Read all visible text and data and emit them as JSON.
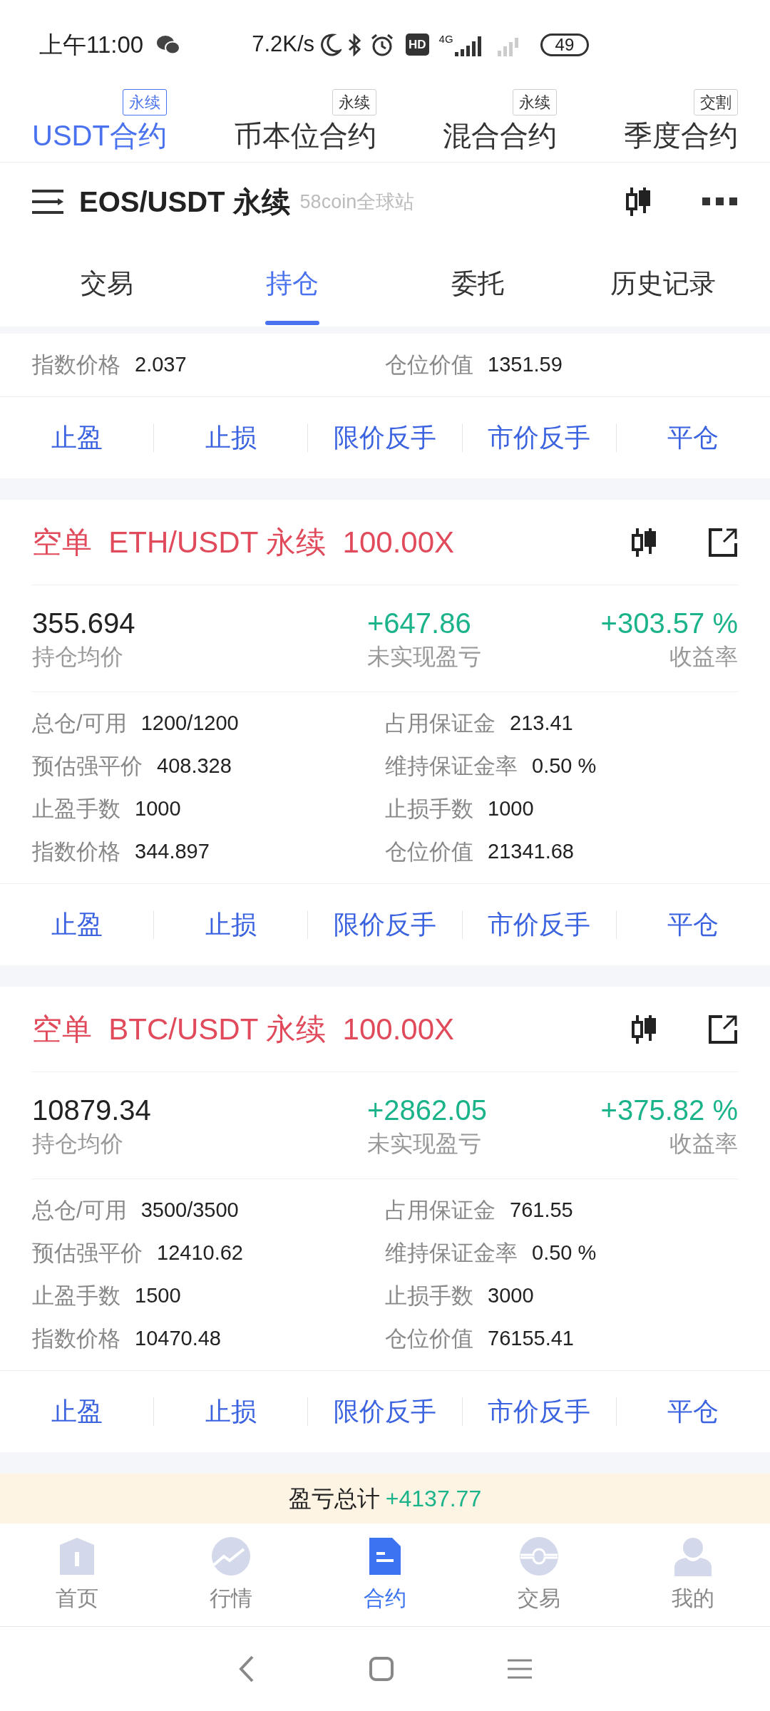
{
  "status_bar": {
    "time": "上午11:00",
    "speed": "7.2K/s",
    "hd": "HD",
    "network": "4G",
    "battery": "49"
  },
  "contract_tabs": [
    {
      "label": "USDT合约",
      "badge": "永续",
      "selected": true
    },
    {
      "label": "币本位合约",
      "badge": "永续",
      "selected": false
    },
    {
      "label": "混合合约",
      "badge": "永续",
      "selected": false
    },
    {
      "label": "季度合约",
      "badge": "交割",
      "selected": false
    }
  ],
  "header": {
    "title": "EOS/USDT 永续",
    "site": "58coin全球站"
  },
  "tabs": [
    {
      "label": "交易",
      "selected": false
    },
    {
      "label": "持仓",
      "selected": true
    },
    {
      "label": "委托",
      "selected": false
    },
    {
      "label": "历史记录",
      "selected": false
    }
  ],
  "positions": [
    {
      "details": [
        {
          "left": {
            "label": "指数价格",
            "value": "2.037"
          },
          "right": {
            "label": "仓位价值",
            "value": "1351.59"
          }
        }
      ],
      "actions": [
        "止盈",
        "止损",
        "限价反手",
        "市价反手",
        "平仓"
      ]
    },
    {
      "side": "空单",
      "symbol": "ETH/USDT 永续",
      "leverage": "100.00X",
      "summary": {
        "avg_price": "355.694",
        "avg_price_label": "持仓均价",
        "pnl": "+647.86",
        "pnl_label": "未实现盈亏",
        "roe": "+303.57 %",
        "roe_label": "收益率"
      },
      "details": [
        {
          "left": {
            "label": "总仓/可用",
            "value": "1200/1200"
          },
          "right": {
            "label": "占用保证金",
            "value": "213.41"
          }
        },
        {
          "left": {
            "label": "预估强平价",
            "value": "408.328"
          },
          "right": {
            "label": "维持保证金率",
            "value": "0.50 %"
          }
        },
        {
          "left": {
            "label": "止盈手数",
            "value": "1000"
          },
          "right": {
            "label": "止损手数",
            "value": "1000"
          }
        },
        {
          "left": {
            "label": "指数价格",
            "value": "344.897"
          },
          "right": {
            "label": "仓位价值",
            "value": "21341.68"
          }
        }
      ],
      "actions": [
        "止盈",
        "止损",
        "限价反手",
        "市价反手",
        "平仓"
      ]
    },
    {
      "side": "空单",
      "symbol": "BTC/USDT 永续",
      "leverage": "100.00X",
      "summary": {
        "avg_price": "10879.34",
        "avg_price_label": "持仓均价",
        "pnl": "+2862.05",
        "pnl_label": "未实现盈亏",
        "roe": "+375.82 %",
        "roe_label": "收益率"
      },
      "details": [
        {
          "left": {
            "label": "总仓/可用",
            "value": "3500/3500"
          },
          "right": {
            "label": "占用保证金",
            "value": "761.55"
          }
        },
        {
          "left": {
            "label": "预估强平价",
            "value": "12410.62"
          },
          "right": {
            "label": "维持保证金率",
            "value": "0.50 %"
          }
        },
        {
          "left": {
            "label": "止盈手数",
            "value": "1500"
          },
          "right": {
            "label": "止损手数",
            "value": "3000"
          }
        },
        {
          "left": {
            "label": "指数价格",
            "value": "10470.48"
          },
          "right": {
            "label": "仓位价值",
            "value": "76155.41"
          }
        }
      ],
      "actions": [
        "止盈",
        "止损",
        "限价反手",
        "市价反手",
        "平仓"
      ]
    }
  ],
  "pnl_total": {
    "label": "盈亏总计",
    "value": "+4137.77"
  },
  "bottom_nav": [
    {
      "label": "首页",
      "selected": false
    },
    {
      "label": "行情",
      "selected": false
    },
    {
      "label": "合约",
      "selected": true
    },
    {
      "label": "交易",
      "selected": false
    },
    {
      "label": "我的",
      "selected": false
    }
  ]
}
